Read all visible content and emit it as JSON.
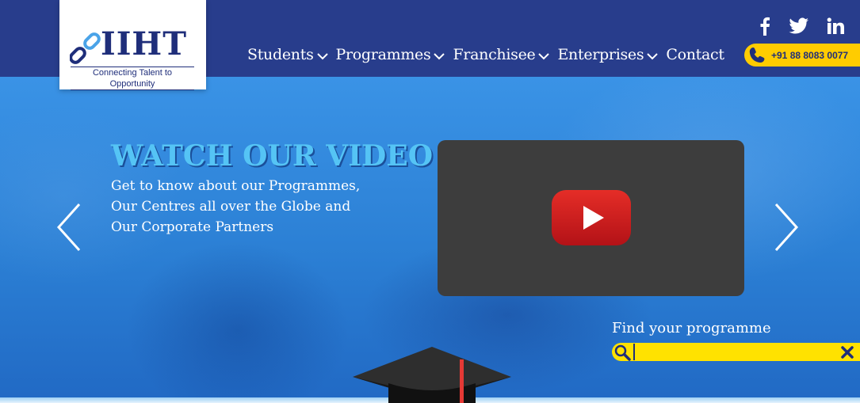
{
  "logo": {
    "name": "IIHT",
    "tagline": "Connecting Talent to Opportunity"
  },
  "nav": {
    "items": [
      {
        "label": "Students",
        "has_dropdown": true
      },
      {
        "label": "Programmes",
        "has_dropdown": true
      },
      {
        "label": "Franchisee",
        "has_dropdown": true
      },
      {
        "label": "Enterprises",
        "has_dropdown": true
      },
      {
        "label": "Contact",
        "has_dropdown": false
      }
    ]
  },
  "social": {
    "icons": [
      "facebook-icon",
      "twitter-icon",
      "linkedin-icon"
    ]
  },
  "contact": {
    "phone": "+91 88 8083 0077",
    "icon": "phone-icon"
  },
  "hero": {
    "title": "WATCH OUR VIDEO",
    "description_lines": [
      "Get to know about our Programmes,",
      "Our Centres all over the Globe and",
      "Our Corporate Partners"
    ],
    "video_icon": "youtube-play-icon",
    "prev_icon": "chevron-left-icon",
    "next_icon": "chevron-right-icon"
  },
  "search": {
    "label": "Find your programme",
    "value": "",
    "placeholder": "",
    "icon": "search-icon",
    "clear_icon": "close-icon"
  },
  "colors": {
    "header": "#283d8c",
    "accent_yellow": "#ffcc00",
    "search_yellow": "#ffe200",
    "title_blue": "#55c4f5",
    "youtube_red": "#e62117",
    "video_bg": "#3d3d3d"
  }
}
